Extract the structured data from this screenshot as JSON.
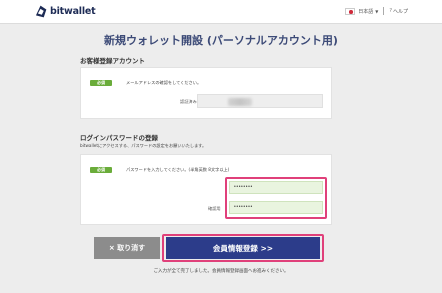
{
  "header": {
    "brand": "bitwallet",
    "language": "日本語",
    "help": "ヘルプ"
  },
  "page": {
    "title": "新規ウォレット開設 (パーソナルアカウント用)"
  },
  "customer_section": {
    "title": "お客様登録アカウント",
    "badge": "必須",
    "instruction": "メールアドレスの確認をしてください。",
    "field_label": "認証済みメールアドレス："
  },
  "password_section": {
    "title": "ログインパスワードの登録",
    "description": "bitwalletにアクセスする、パスワードの設定をお願いいたします。",
    "badge": "必須",
    "instruction": "パスワードを入力してください。(半角英数 8文字以上)",
    "password_value": "••••••••",
    "confirm_label": "確認用",
    "confirm_value": "••••••••"
  },
  "buttons": {
    "cancel": "× 取り消す",
    "submit": "会員情報登録 >>"
  },
  "footer": {
    "note": "ご入力が全て完了しました。会員情報登録画面へお進みください。"
  },
  "colors": {
    "brand_navy": "#1d2b55",
    "badge_green": "#6aac3a",
    "highlight_pink": "#e0407a",
    "submit_blue": "#2c3c8a",
    "cancel_gray": "#8c8c8c"
  }
}
